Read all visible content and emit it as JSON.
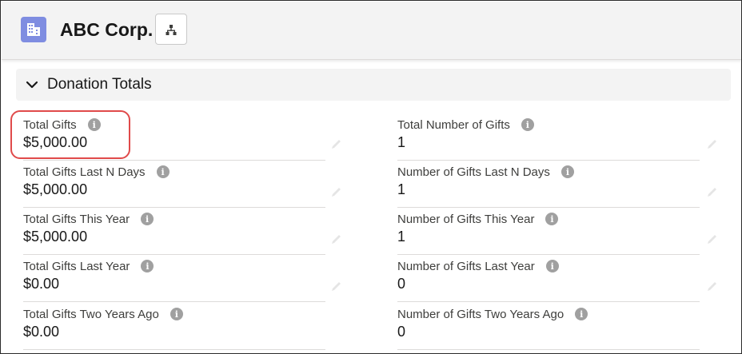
{
  "header": {
    "title": "ABC Corp.",
    "record_icon": "building-icon",
    "hierarchy_icon": "hierarchy-icon",
    "icon_color": "#7f8de1"
  },
  "section": {
    "title": "Donation Totals",
    "chevron_icon": "chevron-down-icon"
  },
  "fields_left": [
    {
      "label": "Total Gifts",
      "value": "$5,000.00"
    },
    {
      "label": "Total Gifts Last N Days",
      "value": "$5,000.00"
    },
    {
      "label": "Total Gifts This Year",
      "value": "$5,000.00"
    },
    {
      "label": "Total Gifts Last Year",
      "value": "$0.00"
    },
    {
      "label": "Total Gifts Two Years Ago",
      "value": "$0.00"
    }
  ],
  "fields_right": [
    {
      "label": "Total Number of Gifts",
      "value": "1"
    },
    {
      "label": "Number of Gifts Last N Days",
      "value": "1"
    },
    {
      "label": "Number of Gifts This Year",
      "value": "1"
    },
    {
      "label": "Number of Gifts Last Year",
      "value": "0"
    },
    {
      "label": "Number of Gifts Two Years Ago",
      "value": "0"
    }
  ],
  "info_glyph": "i",
  "highlight_color": "#e04a4a"
}
